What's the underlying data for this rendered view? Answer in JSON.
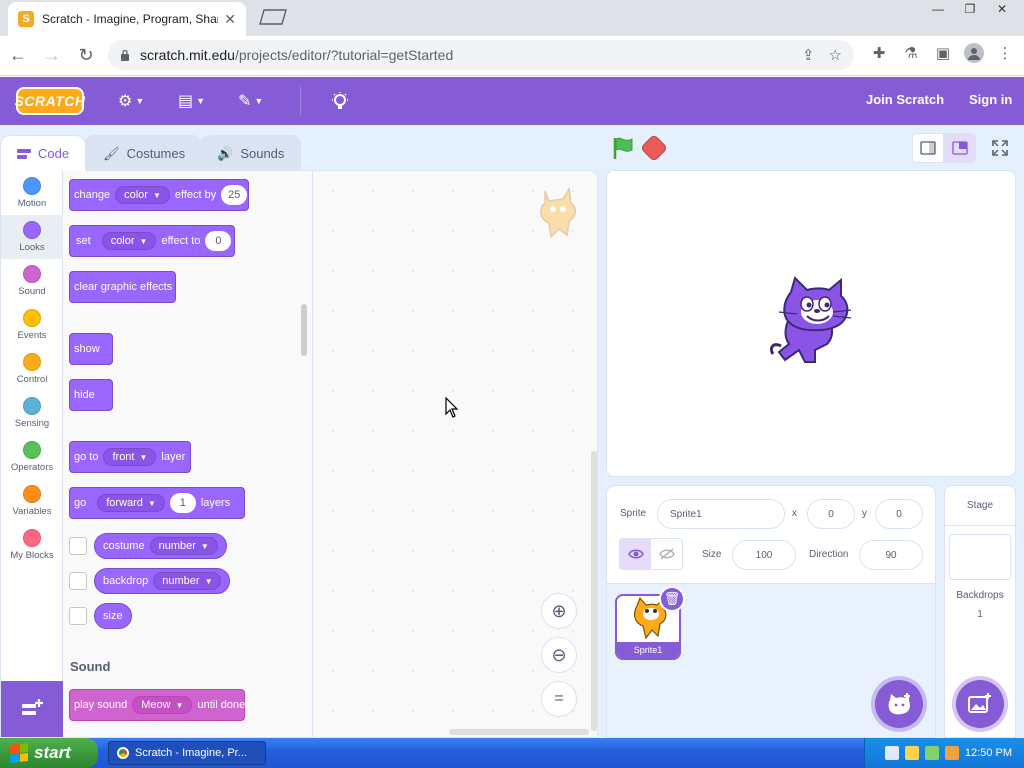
{
  "browser": {
    "tab_title": "Scratch - Imagine, Program, Share",
    "tab_favicon": "S",
    "url_host": "scratch.mit.edu",
    "url_path": "/projects/editor/?tutorial=getStarted",
    "window_controls": [
      "minimize-icon",
      "restore-icon",
      "close-icon"
    ]
  },
  "menubar": {
    "logo": "SCRATCH",
    "join": "Join Scratch",
    "signin": "Sign in",
    "color": "#855cd6"
  },
  "tabs": [
    {
      "label": "Code"
    },
    {
      "label": "Costumes"
    },
    {
      "label": "Sounds"
    }
  ],
  "categories": [
    {
      "label": "Motion",
      "color": "#4c97ff"
    },
    {
      "label": "Looks",
      "color": "#9966ff"
    },
    {
      "label": "Sound",
      "color": "#cf63cf"
    },
    {
      "label": "Events",
      "color": "#ffbf00"
    },
    {
      "label": "Control",
      "color": "#ffab19"
    },
    {
      "label": "Sensing",
      "color": "#5cb1d6"
    },
    {
      "label": "Operators",
      "color": "#59c059"
    },
    {
      "label": "Variables",
      "color": "#ff8c1a"
    },
    {
      "label": "My Blocks",
      "color": "#ff6680"
    }
  ],
  "blocks": {
    "change_effect": {
      "a": "change",
      "dd": "color",
      "b": "effect by",
      "val": "25"
    },
    "set_effect": {
      "a": "set",
      "dd": "color",
      "b": "effect to",
      "val": "0"
    },
    "clear": "clear graphic effects",
    "show": "show",
    "hide": "hide",
    "goto_layer": {
      "a": "go to",
      "dd": "front",
      "b": "layer"
    },
    "go_layers": {
      "a": "go",
      "dd": "forward",
      "val": "1",
      "b": "layers"
    },
    "costume": {
      "a": "costume",
      "dd": "number"
    },
    "backdrop": {
      "a": "backdrop",
      "dd": "number"
    },
    "size": "size",
    "sound_title": "Sound",
    "play_sound": {
      "a": "play sound",
      "dd": "Meow",
      "b": "until done"
    }
  },
  "sprite": {
    "label": "Sprite",
    "name": "Sprite1",
    "x_label": "x",
    "x": "0",
    "y_label": "y",
    "y": "0",
    "show_label": "Show",
    "size_label": "Size",
    "size": "100",
    "direction_label": "Direction",
    "direction": "90",
    "tile_name": "Sprite1"
  },
  "stage_pane": {
    "title": "Stage",
    "backdrops_label": "Backdrops",
    "backdrops_count": "1"
  },
  "taskbar": {
    "start": "start",
    "task": "Scratch - Imagine, Pr...",
    "clock": "12:50 PM"
  }
}
